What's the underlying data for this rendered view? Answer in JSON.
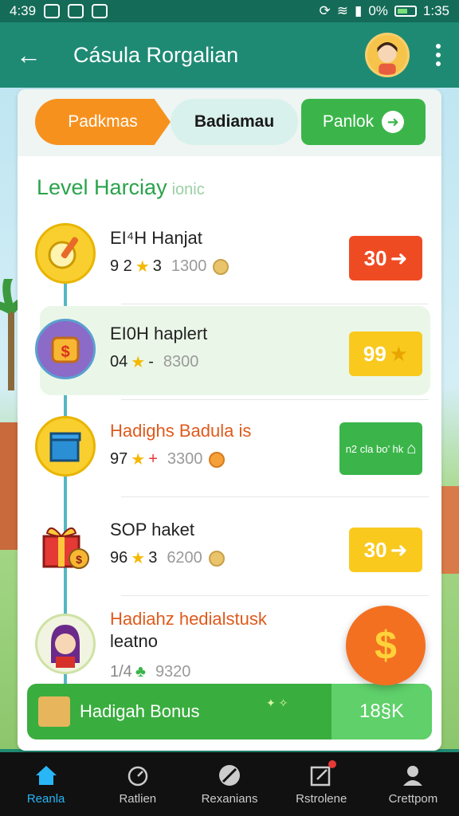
{
  "status_bar": {
    "time_left": "4:39",
    "battery": "0%",
    "time_right": "1:35"
  },
  "app_bar": {
    "title": "Cásula Rorgalian"
  },
  "tabs": [
    {
      "label": "Padkmas"
    },
    {
      "label": "Badiamau"
    },
    {
      "label": "Panlok"
    }
  ],
  "section": {
    "heading": "Level Harciay",
    "heading_suffix": "ionic"
  },
  "rows": [
    {
      "title": "EI⁴H Hanjat",
      "level": "9 2",
      "level_suffix": "3",
      "points": "1300",
      "badge": "30",
      "badge_arrow": "➜",
      "badge_color": "#ef4b23"
    },
    {
      "title": "EI0H haplert",
      "level": "04",
      "level_suffix": "-",
      "points": "8300",
      "badge": "99",
      "badge_arrow": "★",
      "badge_color": "#f9c91e"
    },
    {
      "title": "Hadighs Badula is",
      "level": "97",
      "level_suffix": "+",
      "points": "3300",
      "badge": "n2 cla bo’ hk",
      "badge_arrow": "",
      "badge_color": "#3bb54a"
    },
    {
      "title": "SOP haket",
      "level": "96",
      "level_suffix": "3",
      "points": "6200",
      "badge": "30",
      "badge_arrow": "➜",
      "badge_color": "#f9c91e"
    },
    {
      "title": "Hadiahz hedialstusk",
      "title2": "leatno",
      "level": "1/4",
      "level_suffix": "",
      "points": "9320"
    }
  ],
  "bonus": {
    "label": "Hadigah Bonus",
    "value": "18§K"
  },
  "fab": {
    "symbol": "$"
  },
  "nav": [
    {
      "label": "Reanla",
      "icon": "home-icon"
    },
    {
      "label": "Ratlien",
      "icon": "timer-icon"
    },
    {
      "label": "Rexanians",
      "icon": "compass-icon"
    },
    {
      "label": "Rstrolene",
      "icon": "edit-icon"
    },
    {
      "label": "Crettpom",
      "icon": "profile-icon"
    }
  ],
  "colors": {
    "primary": "#1e8a74",
    "accent_green": "#3bb54a",
    "accent_orange": "#f7911e",
    "nav_active": "#29b6f6"
  }
}
